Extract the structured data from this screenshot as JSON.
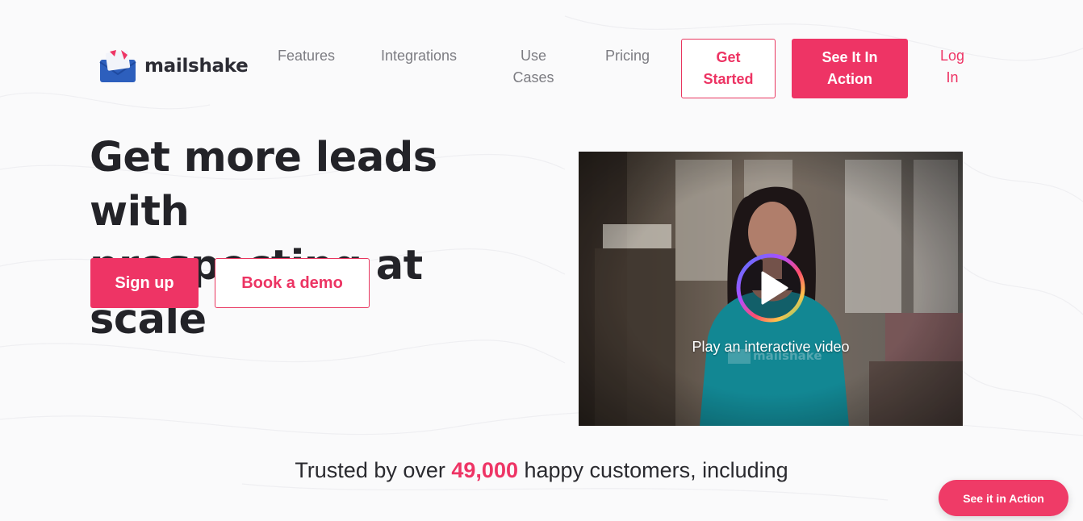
{
  "brand": {
    "name": "mailshake",
    "accent": "#ee3465"
  },
  "nav": {
    "features": "Features",
    "integrations": "Integrations",
    "use_cases_line1": "Use",
    "use_cases_line2": "Cases",
    "pricing": "Pricing",
    "get_started_line1": "Get",
    "get_started_line2": "Started",
    "see_it_line1": "See It In",
    "see_it_line2": "Action",
    "login_line1": "Log",
    "login_line2": "In"
  },
  "hero": {
    "title_line1": "Get more leads with",
    "title_line2": "prospecting at scale",
    "signup_label": "Sign up",
    "demo_label": "Book a demo"
  },
  "video": {
    "caption": "Play an interactive video",
    "shirt_logo": "mailshake",
    "icon": "play-icon"
  },
  "trusted": {
    "prefix": "Trusted by over ",
    "count": "49,000",
    "suffix": " happy customers, including"
  },
  "floating_button": {
    "label": "See it in Action"
  }
}
